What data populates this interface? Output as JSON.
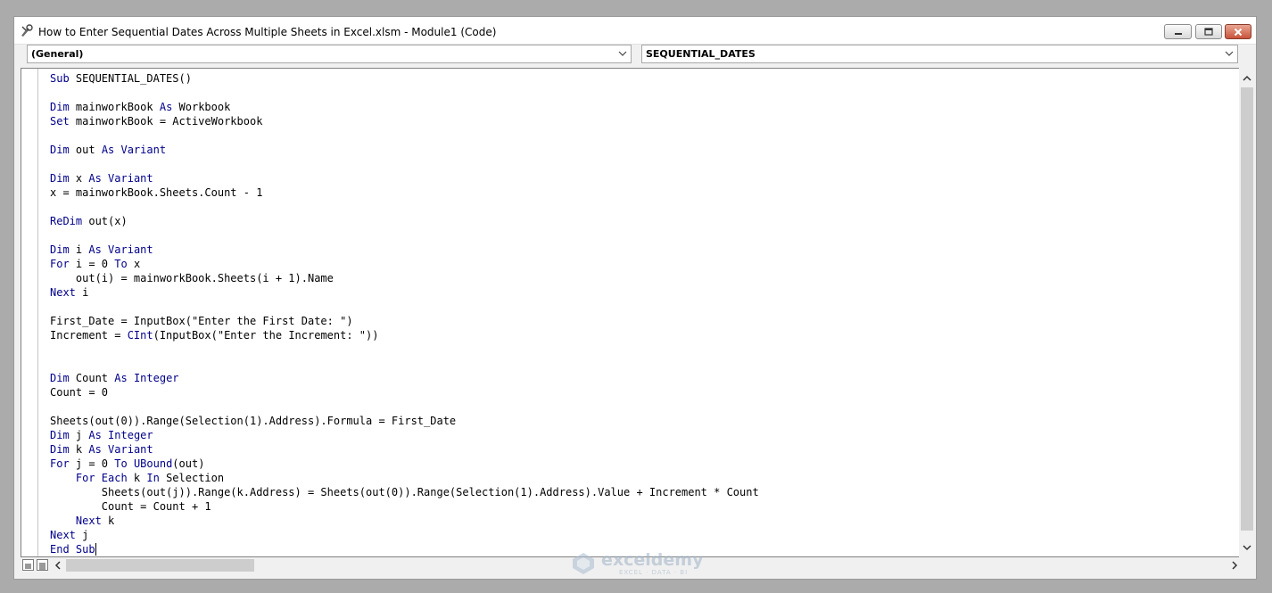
{
  "window": {
    "title": "How to Enter Sequential Dates Across Multiple Sheets in Excel.xlsm - Module1 (Code)"
  },
  "object_combo": {
    "value": "(General)"
  },
  "procedure_combo": {
    "value": "SEQUENTIAL_DATES"
  },
  "code_lines": [
    [
      {
        "t": "Sub",
        "k": true
      },
      {
        "t": " SEQUENTIAL_DATES()"
      }
    ],
    [],
    [
      {
        "t": "Dim",
        "k": true
      },
      {
        "t": " mainworkBook "
      },
      {
        "t": "As",
        "k": true
      },
      {
        "t": " Workbook"
      }
    ],
    [
      {
        "t": "Set",
        "k": true
      },
      {
        "t": " mainworkBook = ActiveWorkbook"
      }
    ],
    [],
    [
      {
        "t": "Dim",
        "k": true
      },
      {
        "t": " out "
      },
      {
        "t": "As Variant",
        "k": true
      }
    ],
    [],
    [
      {
        "t": "Dim",
        "k": true
      },
      {
        "t": " x "
      },
      {
        "t": "As Variant",
        "k": true
      }
    ],
    [
      {
        "t": "x = mainworkBook.Sheets.Count - 1"
      }
    ],
    [],
    [
      {
        "t": "ReDim",
        "k": true
      },
      {
        "t": " out(x)"
      }
    ],
    [],
    [
      {
        "t": "Dim",
        "k": true
      },
      {
        "t": " i "
      },
      {
        "t": "As Variant",
        "k": true
      }
    ],
    [
      {
        "t": "For",
        "k": true
      },
      {
        "t": " i = 0 "
      },
      {
        "t": "To",
        "k": true
      },
      {
        "t": " x"
      }
    ],
    [
      {
        "t": "    out(i) = mainworkBook.Sheets(i + 1).Name"
      }
    ],
    [
      {
        "t": "Next",
        "k": true
      },
      {
        "t": " i"
      }
    ],
    [],
    [
      {
        "t": "First_Date = InputBox(\"Enter the First Date: \")"
      }
    ],
    [
      {
        "t": "Increment = "
      },
      {
        "t": "CInt",
        "k": true
      },
      {
        "t": "(InputBox(\"Enter the Increment: \"))"
      }
    ],
    [],
    [],
    [
      {
        "t": "Dim",
        "k": true
      },
      {
        "t": " Count "
      },
      {
        "t": "As Integer",
        "k": true
      }
    ],
    [
      {
        "t": "Count = 0"
      }
    ],
    [],
    [
      {
        "t": "Sheets(out(0)).Range(Selection(1).Address).Formula = First_Date"
      }
    ],
    [
      {
        "t": "Dim",
        "k": true
      },
      {
        "t": " j "
      },
      {
        "t": "As Integer",
        "k": true
      }
    ],
    [
      {
        "t": "Dim",
        "k": true
      },
      {
        "t": " k "
      },
      {
        "t": "As Variant",
        "k": true
      }
    ],
    [
      {
        "t": "For",
        "k": true
      },
      {
        "t": " j = 0 "
      },
      {
        "t": "To UBound",
        "k": true
      },
      {
        "t": "(out)"
      }
    ],
    [
      {
        "t": "    "
      },
      {
        "t": "For Each",
        "k": true
      },
      {
        "t": " k "
      },
      {
        "t": "In",
        "k": true
      },
      {
        "t": " Selection"
      }
    ],
    [
      {
        "t": "        Sheets(out(j)).Range(k.Address) = Sheets(out(0)).Range(Selection(1).Address).Value + Increment * Count"
      }
    ],
    [
      {
        "t": "        Count = Count + 1"
      }
    ],
    [
      {
        "t": "    "
      },
      {
        "t": "Next",
        "k": true
      },
      {
        "t": " k"
      }
    ],
    [
      {
        "t": "Next",
        "k": true
      },
      {
        "t": " j"
      }
    ],
    [
      {
        "t": "End Sub",
        "k": true
      }
    ]
  ],
  "icons": {
    "title": "vbe-module-icon",
    "minimize": "minimize-icon",
    "maximize": "maximize-icon",
    "close": "close-icon"
  },
  "colors": {
    "keyword": "#00008b",
    "text": "#000000",
    "close_button": "#c9543c"
  },
  "watermark": {
    "brand": "exceldemy",
    "tagline": "EXCEL · DATA · BI"
  }
}
